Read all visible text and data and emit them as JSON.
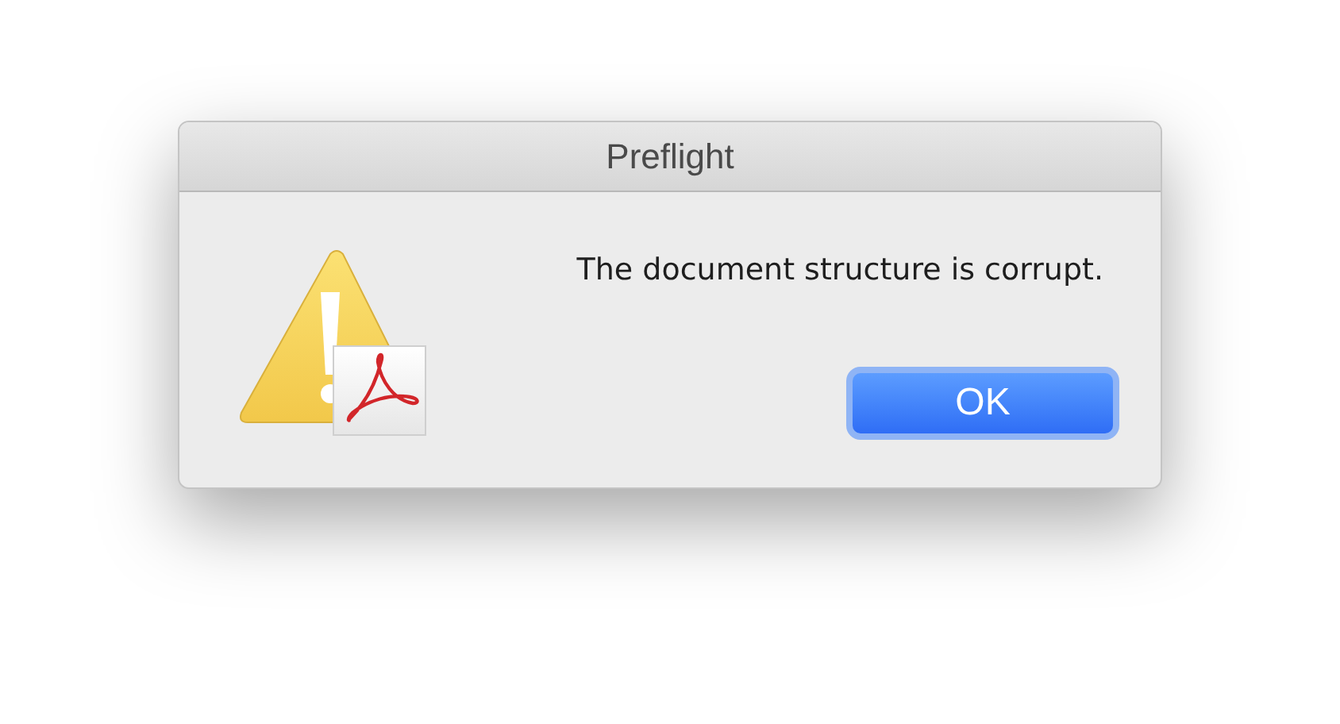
{
  "window": {
    "title": "Preflight"
  },
  "message": "The document structure is corrupt.",
  "buttons": [
    {
      "label": "OK",
      "default": true
    }
  ]
}
